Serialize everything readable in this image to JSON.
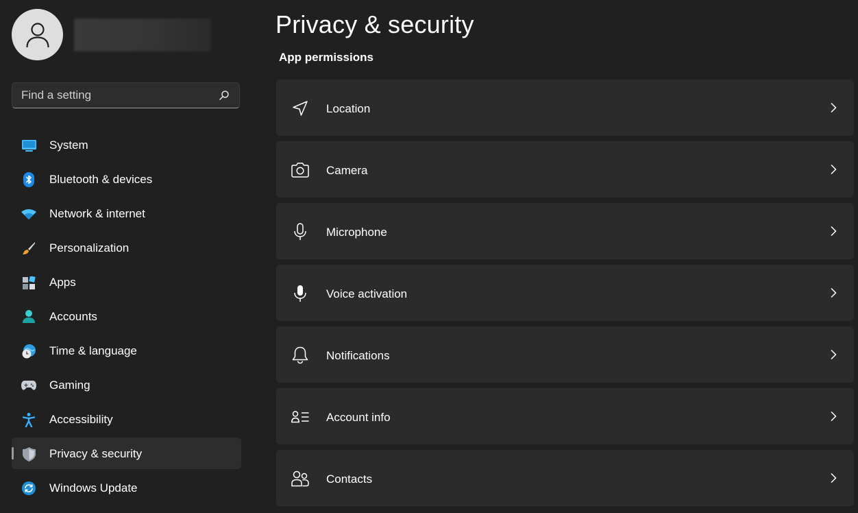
{
  "app": {
    "accent_color": "#0078d4",
    "background_color": "#202020",
    "card_color": "#2b2b2b"
  },
  "profile": {
    "avatar_icon": "user-avatar-icon",
    "name": "",
    "email": ""
  },
  "search": {
    "placeholder": "Find a setting",
    "value": "",
    "icon": "search-icon"
  },
  "sidebar": {
    "items": [
      {
        "label": "System",
        "icon": "system-icon",
        "selected": false
      },
      {
        "label": "Bluetooth & devices",
        "icon": "bluetooth-icon",
        "selected": false
      },
      {
        "label": "Network & internet",
        "icon": "wifi-icon",
        "selected": false
      },
      {
        "label": "Personalization",
        "icon": "paintbrush-icon",
        "selected": false
      },
      {
        "label": "Apps",
        "icon": "apps-icon",
        "selected": false
      },
      {
        "label": "Accounts",
        "icon": "accounts-icon",
        "selected": false
      },
      {
        "label": "Time & language",
        "icon": "time-language-icon",
        "selected": false
      },
      {
        "label": "Gaming",
        "icon": "gamepad-icon",
        "selected": false
      },
      {
        "label": "Accessibility",
        "icon": "accessibility-icon",
        "selected": false
      },
      {
        "label": "Privacy & security",
        "icon": "shield-icon",
        "selected": true
      },
      {
        "label": "Windows Update",
        "icon": "windows-update-icon",
        "selected": false
      }
    ]
  },
  "main": {
    "title": "Privacy & security",
    "section_title": "App permissions",
    "items": [
      {
        "label": "Location",
        "icon": "location-icon"
      },
      {
        "label": "Camera",
        "icon": "camera-icon"
      },
      {
        "label": "Microphone",
        "icon": "microphone-icon"
      },
      {
        "label": "Voice activation",
        "icon": "voice-activation-icon"
      },
      {
        "label": "Notifications",
        "icon": "bell-icon"
      },
      {
        "label": "Account info",
        "icon": "account-info-icon"
      },
      {
        "label": "Contacts",
        "icon": "contacts-icon"
      }
    ]
  }
}
